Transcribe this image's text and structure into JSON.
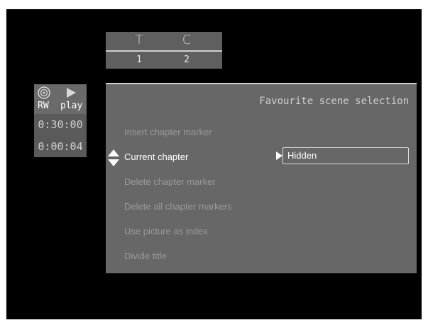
{
  "tc": {
    "title_label": "T",
    "chapter_label": "C",
    "title_value": "1",
    "chapter_value": "2"
  },
  "side": {
    "disc_label": "RW",
    "mode_label": "play",
    "total_time": "0:30:00",
    "elapsed_time": "0:00:04"
  },
  "menu": {
    "title": "Favourite scene selection",
    "items": [
      {
        "label": "Insert chapter marker"
      },
      {
        "label": "Current chapter"
      },
      {
        "label": "Delete chapter marker"
      },
      {
        "label": "Delete all chapter markers"
      },
      {
        "label": "Use picture as index"
      },
      {
        "label": "Divide title"
      }
    ],
    "current_value": "Hidden"
  },
  "colors": {
    "screen": "#000000",
    "panel": "#676767",
    "inactive_text": "#9a9a9a",
    "active_text": "#ffffff"
  }
}
